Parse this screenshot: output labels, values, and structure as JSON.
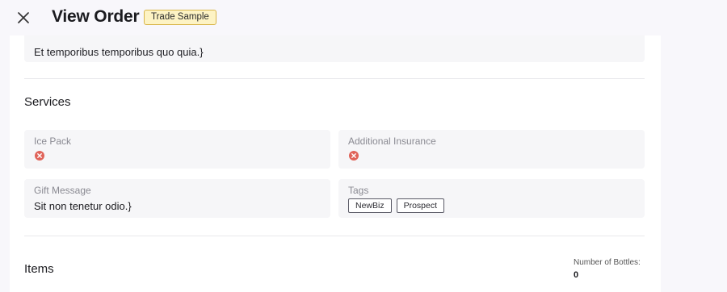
{
  "header": {
    "title": "View Order",
    "badge": "Trade Sample"
  },
  "top_card": {
    "value": "Et temporibus temporibus quo quia.}"
  },
  "services": {
    "title": "Services",
    "ice_pack": {
      "label": "Ice Pack",
      "value_icon": "x-circle-icon"
    },
    "additional_insurance": {
      "label": "Additional Insurance",
      "value_icon": "x-circle-icon"
    },
    "gift_message": {
      "label": "Gift Message",
      "value": "Sit non tenetur odio.}"
    },
    "tags": {
      "label": "Tags",
      "items": [
        "NewBiz",
        "Prospect"
      ]
    }
  },
  "items": {
    "title": "Items",
    "bottles_label": "Number of Bottles:",
    "bottles_value": "0"
  },
  "colors": {
    "page_bg": "#f8f7fb",
    "badge_bg": "#fdf3c4",
    "badge_border": "#d8b54a",
    "field_bg": "#f6f6f8",
    "no_icon": "#e0645a"
  }
}
